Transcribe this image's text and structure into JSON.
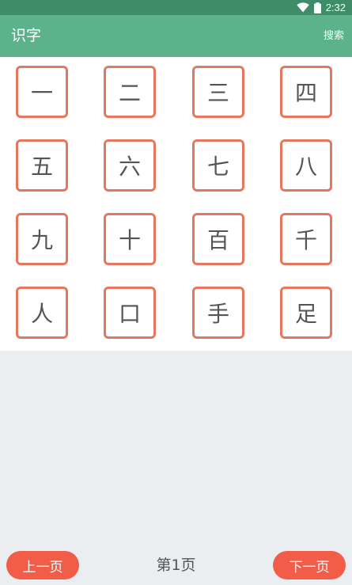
{
  "status_bar": {
    "time": "2:32",
    "icons": [
      "wifi-icon",
      "battery-icon"
    ]
  },
  "app_bar": {
    "title": "识字",
    "action_label": "搜索"
  },
  "characters": [
    "一",
    "二",
    "三",
    "四",
    "五",
    "六",
    "七",
    "八",
    "九",
    "十",
    "百",
    "千",
    "人",
    "口",
    "手",
    "足"
  ],
  "pager": {
    "prev_label": "上一页",
    "page_label": "第1页",
    "next_label": "下一页"
  },
  "colors": {
    "status_bar": "#3e8c68",
    "app_bar": "#5cb38b",
    "card_border": "#e5775f",
    "button": "#f25d49",
    "background": "#ebeef0"
  }
}
